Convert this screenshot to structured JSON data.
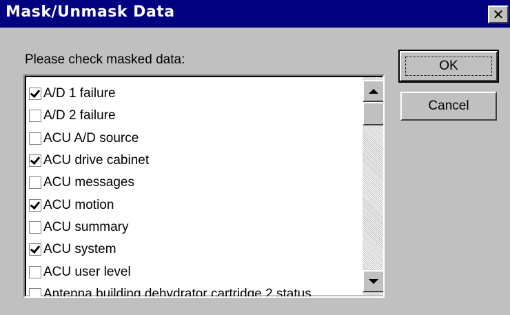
{
  "window": {
    "title": "Mask/Unmask Data",
    "close_label": "✕"
  },
  "prompt": "Please check masked data:",
  "list": {
    "items": [
      {
        "label": "A/D 1 failure",
        "checked": true
      },
      {
        "label": "A/D 2 failure",
        "checked": false
      },
      {
        "label": "ACU A/D source",
        "checked": false
      },
      {
        "label": "ACU drive cabinet",
        "checked": true
      },
      {
        "label": "ACU messages",
        "checked": false
      },
      {
        "label": "ACU motion",
        "checked": true
      },
      {
        "label": "ACU summary",
        "checked": false
      },
      {
        "label": "ACU system",
        "checked": true
      },
      {
        "label": "ACU user level",
        "checked": false
      },
      {
        "label": "Antenna building dehydrator cartridge 2 status",
        "checked": false
      }
    ]
  },
  "buttons": {
    "ok_label": "OK",
    "cancel_label": "Cancel"
  },
  "colors": {
    "titlebar": "#000080",
    "face": "#c0c0c0"
  }
}
